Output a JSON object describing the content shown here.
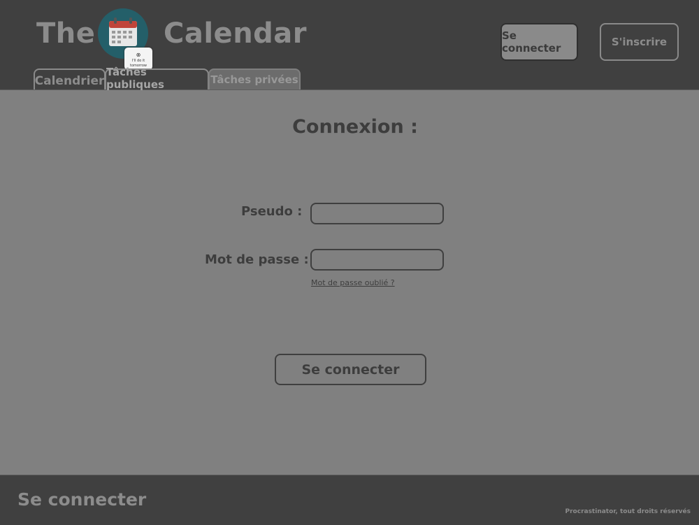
{
  "header": {
    "brand_left": "The",
    "brand_right": "Calendar",
    "logo_note": "I'll do it tomorrow",
    "login_label": "Se connecter",
    "signup_label": "S'inscrire"
  },
  "tabs": [
    {
      "label": "Calendrier"
    },
    {
      "label": "Tâches publiques"
    },
    {
      "label": "Tâches privées"
    }
  ],
  "form": {
    "title": "Connexion :",
    "pseudo_label": "Pseudo :",
    "pseudo_value": "",
    "password_label": "Mot de passe :",
    "password_value": "",
    "forgot_label": "Mot de passe oublié ?",
    "submit_label": "Se connecter"
  },
  "footer": {
    "title": "Se connecter",
    "copyright": "Procrastinator, tout droits réservés"
  },
  "colors": {
    "header_bg": "#404040",
    "page_bg": "#808080",
    "logo_teal": "#245f69",
    "logo_red": "#c0453a"
  }
}
